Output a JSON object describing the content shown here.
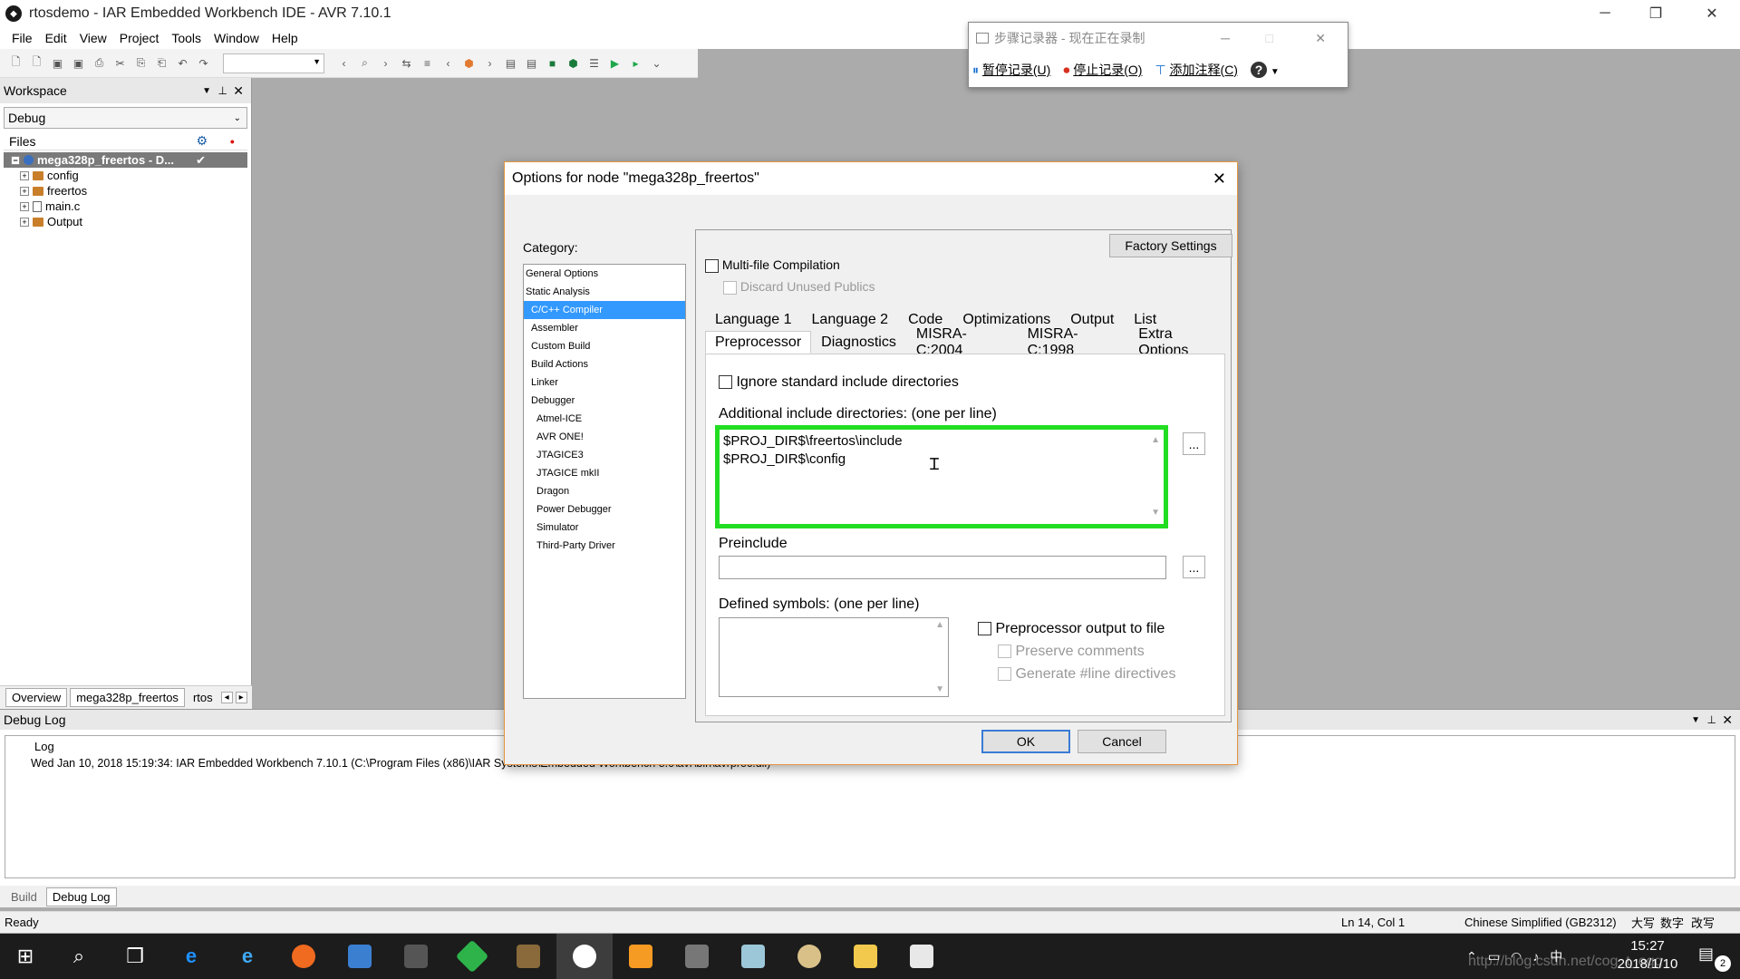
{
  "window": {
    "title": "rtosdemo - IAR Embedded Workbench IDE - AVR 7.10.1"
  },
  "menu": [
    "File",
    "Edit",
    "View",
    "Project",
    "Tools",
    "Window",
    "Help"
  ],
  "workspace": {
    "title": "Workspace",
    "config": "Debug",
    "files_label": "Files",
    "tree": [
      {
        "label": "mega328p_freertos - D...",
        "level": 0,
        "type": "project"
      },
      {
        "label": "config",
        "level": 1,
        "type": "folder"
      },
      {
        "label": "freertos",
        "level": 1,
        "type": "folder"
      },
      {
        "label": "main.c",
        "level": 1,
        "type": "file"
      },
      {
        "label": "Output",
        "level": 1,
        "type": "folder"
      }
    ],
    "tabs": [
      "Overview",
      "mega328p_freertos",
      "rtos"
    ]
  },
  "steps_recorder": {
    "title": "步骤记录器 - 现在正在录制",
    "pause": "暂停记录(U)",
    "stop": "停止记录(O)",
    "comment": "添加注释(C)",
    "help": "?"
  },
  "dialog": {
    "title": "Options for node \"mega328p_freertos\"",
    "category_label": "Category:",
    "categories": [
      {
        "label": "General Options",
        "indent": 0,
        "selected": false
      },
      {
        "label": "Static Analysis",
        "indent": 0,
        "selected": false
      },
      {
        "label": "C/C++ Compiler",
        "indent": 1,
        "selected": true
      },
      {
        "label": "Assembler",
        "indent": 1,
        "selected": false
      },
      {
        "label": "Custom Build",
        "indent": 1,
        "selected": false
      },
      {
        "label": "Build Actions",
        "indent": 1,
        "selected": false
      },
      {
        "label": "Linker",
        "indent": 1,
        "selected": false
      },
      {
        "label": "Debugger",
        "indent": 1,
        "selected": false
      },
      {
        "label": "Atmel-ICE",
        "indent": 2,
        "selected": false
      },
      {
        "label": "AVR ONE!",
        "indent": 2,
        "selected": false
      },
      {
        "label": "JTAGICE3",
        "indent": 2,
        "selected": false
      },
      {
        "label": "JTAGICE mkII",
        "indent": 2,
        "selected": false
      },
      {
        "label": "Dragon",
        "indent": 2,
        "selected": false
      },
      {
        "label": "Power Debugger",
        "indent": 2,
        "selected": false
      },
      {
        "label": "Simulator",
        "indent": 2,
        "selected": false
      },
      {
        "label": "Third-Party Driver",
        "indent": 2,
        "selected": false
      }
    ],
    "factory_settings": "Factory Settings",
    "multifile": "Multi-file Compilation",
    "discard_unused": "Discard Unused Publics",
    "tabs_row1": [
      "Language 1",
      "Language 2",
      "Code",
      "Optimizations",
      "Output",
      "List"
    ],
    "tabs_row2": [
      "Preprocessor",
      "Diagnostics",
      "MISRA-C:2004",
      "MISRA-C:1998",
      "Extra Options"
    ],
    "selected_tab": "Preprocessor",
    "ignore_std": "Ignore standard include directories",
    "include_label": "Additional include directories: (one per line)",
    "include_lines": [
      "$PROJ_DIR$\\freertos\\include",
      "$PROJ_DIR$\\config"
    ],
    "preinclude_label": "Preinclude",
    "preinclude_value": "",
    "defined_label": "Defined symbols: (one per line)",
    "pp_output": "Preprocessor output to file",
    "preserve_comments": "Preserve comments",
    "gen_line": "Generate #line directives",
    "browse": "...",
    "ok": "OK",
    "cancel": "Cancel",
    "highlight_color": "#22dd22"
  },
  "debuglog": {
    "title": "Debug Log",
    "col": "Log",
    "entry": "Wed Jan 10, 2018 15:19:34: IAR Embedded Workbench 7.10.1 (C:\\Program Files (x86)\\IAR Systems\\Embedded Workbench 8.0\\avr\\bin\\avrproc.dll)"
  },
  "bottom_tabs": [
    "Build",
    "Debug Log"
  ],
  "status": {
    "ready": "Ready",
    "position": "Ln 14, Col 1",
    "encoding": "Chinese Simplified (GB2312)",
    "caps": "大写",
    "num": "数字",
    "ovr": "改写"
  },
  "taskbar": {
    "time": "15:27",
    "date": "2018/1/10",
    "ime": "中",
    "watermark": "http://blog.csdn.net/cog_t_ogg",
    "notif": "2"
  }
}
